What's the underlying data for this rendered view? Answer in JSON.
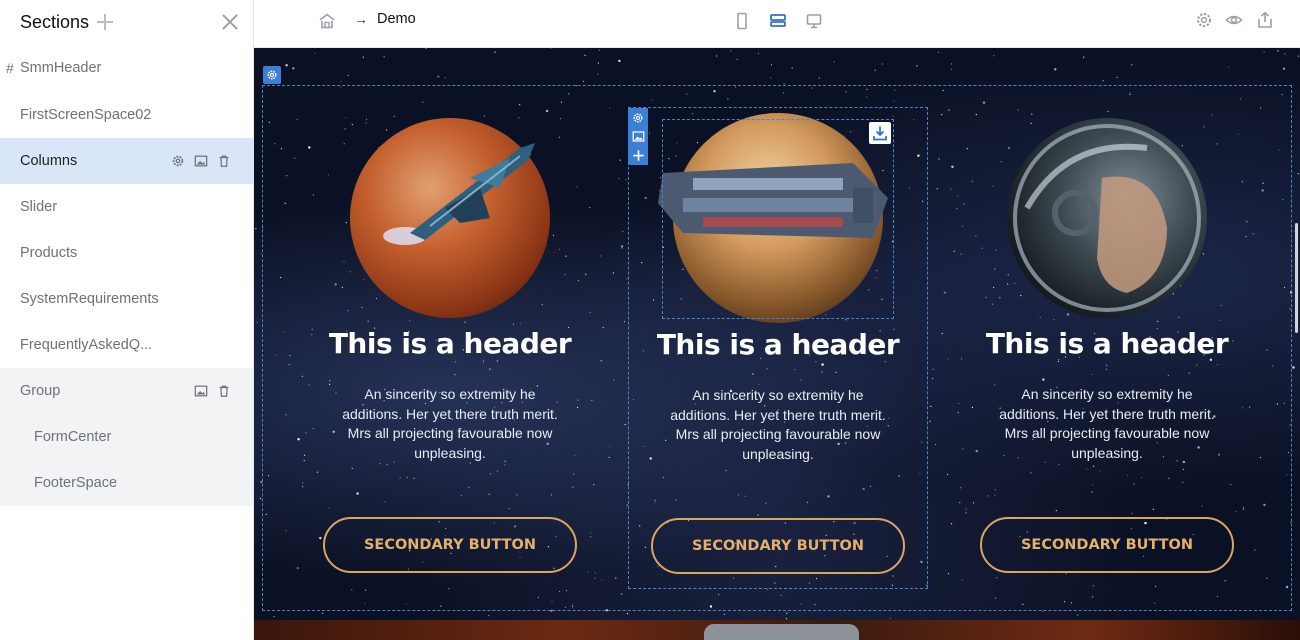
{
  "sidebar": {
    "title": "Sections",
    "items": [
      {
        "label": "SmmHeader",
        "prefix": "#"
      },
      {
        "label": "FirstScreenSpace02"
      },
      {
        "label": "Columns"
      },
      {
        "label": "Slider"
      },
      {
        "label": "Products"
      },
      {
        "label": "SystemRequirements"
      },
      {
        "label": "FrequentlyAskedQ..."
      },
      {
        "label": "Group"
      },
      {
        "label": "FormCenter"
      },
      {
        "label": "FooterSpace"
      }
    ]
  },
  "topbar": {
    "arrow": "→",
    "page_name": "Demo"
  },
  "columns": [
    {
      "header": "This is a header",
      "text": "An sincerity so extremity he additions. Her yet there truth merit. Mrs all projecting favourable now unpleasing.",
      "button": "SECONDARY BUTTON",
      "image": "mars-spaceship"
    },
    {
      "header": "This is a header",
      "text": "An sincerity so extremity he additions. Her yet there truth merit. Mrs all projecting favourable now unpleasing.",
      "button": "SECONDARY BUTTON",
      "image": "jupiter-spacestation"
    },
    {
      "header": "This is a header",
      "text": "An sincerity so extremity he additions. Her yet there truth merit. Mrs all projecting favourable now unpleasing.",
      "button": "SECONDARY BUTTON",
      "image": "astronaut-helmet"
    }
  ],
  "colors": {
    "accent": "#3d7fd4",
    "active_item_bg": "#d8e6f7",
    "button_border": "#d9a563",
    "canvas_bg": "#0b1124"
  },
  "icons": [
    "plus-icon",
    "close-icon",
    "gear-icon",
    "image-icon",
    "trash-icon",
    "home-icon",
    "mobile-icon",
    "tablet-icon",
    "desktop-icon",
    "eye-icon",
    "export-icon",
    "download-icon"
  ]
}
